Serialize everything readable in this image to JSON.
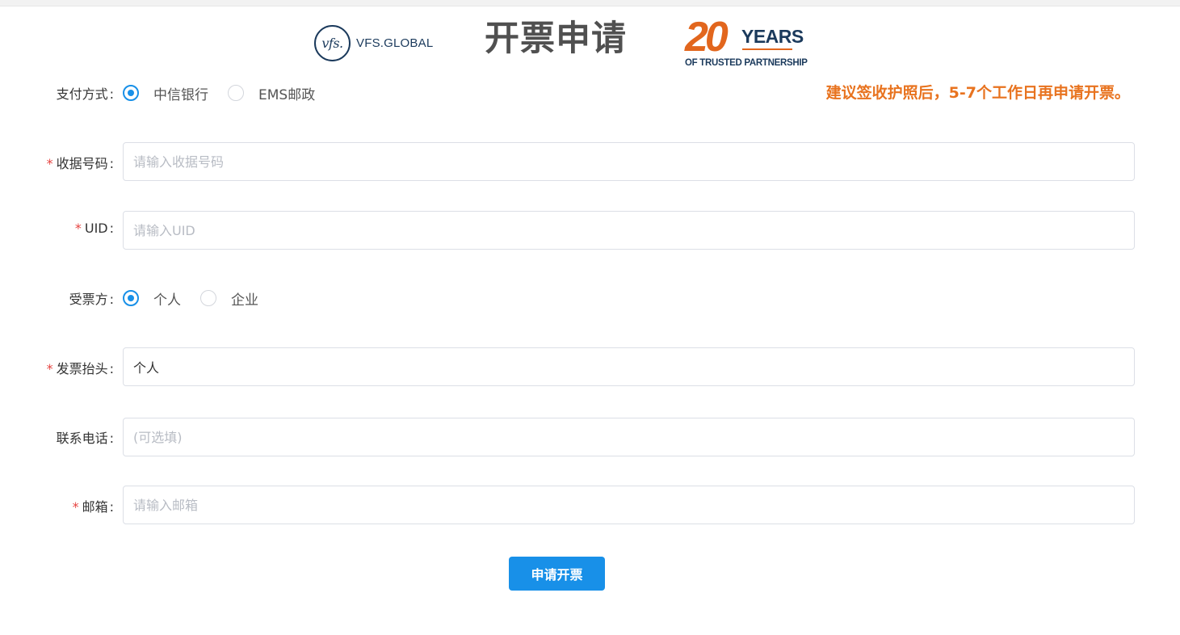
{
  "header": {
    "logo_mark": "vfs.",
    "logo_text": "VFS.GLOBAL",
    "title": "开票申请",
    "anniversary_number": "20",
    "anniversary_word": "YEARS",
    "anniversary_tagline": "OF TRUSTED PARTNERSHIP"
  },
  "notice": "建议签收护照后，5-7个工作日再申请开票。",
  "form": {
    "payment": {
      "label": "支付方式",
      "options": [
        "中信银行",
        "EMS邮政"
      ],
      "selected": "中信银行"
    },
    "receipt_no": {
      "label": "收据号码",
      "required": true,
      "value": "",
      "placeholder": "请输入收据号码"
    },
    "uid": {
      "label": "UID",
      "required": true,
      "value": "",
      "placeholder": "请输入UID"
    },
    "recipient": {
      "label": "受票方",
      "options": [
        "个人",
        "企业"
      ],
      "selected": "个人"
    },
    "invoice_title": {
      "label": "发票抬头",
      "required": true,
      "value": "个人",
      "placeholder": ""
    },
    "phone": {
      "label": "联系电话",
      "required": false,
      "value": "",
      "placeholder": "(可选填)"
    },
    "email": {
      "label": "邮箱",
      "required": true,
      "value": "",
      "placeholder": "请输入邮箱"
    },
    "submit_label": "申请开票"
  },
  "colors": {
    "accent": "#1890e8",
    "notice": "#e8731f",
    "required": "#e64340"
  }
}
